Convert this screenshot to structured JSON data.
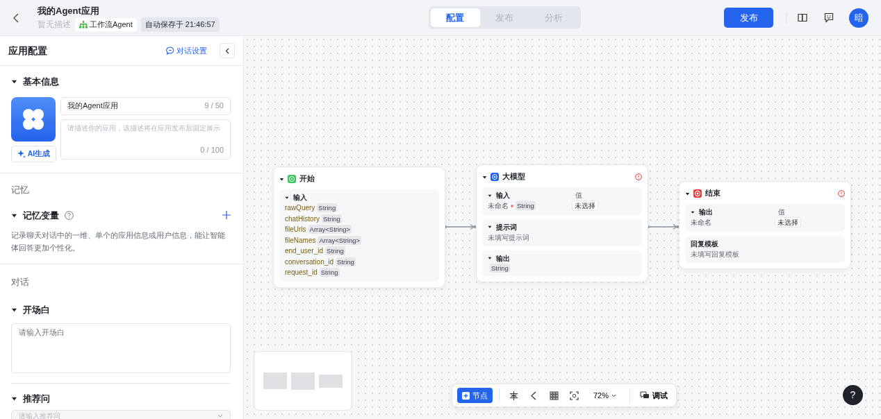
{
  "header": {
    "title": "我的Agent应用",
    "description": "暂无描述",
    "type_tag": "工作流Agent",
    "autosave": "自动保存于 21:46:57",
    "tabs": [
      {
        "label": "配置",
        "selected": true
      },
      {
        "label": "发布",
        "selected": false
      },
      {
        "label": "分析",
        "selected": false
      }
    ],
    "publish_button": "发布",
    "avatar": "暗"
  },
  "config_panel": {
    "title": "应用配置",
    "dialog_settings_link": "对话设置",
    "basic_info": {
      "heading": "基本信息",
      "expanded": true,
      "name_value": "我的Agent应用",
      "name_count": "9 / 50",
      "description_placeholder": "请描述你的应用，该描述将在应用发布后固定展示",
      "description_count": "0 / 100",
      "ai_button": "AI生成"
    },
    "memory": {
      "group_title": "记忆",
      "heading": "记忆变量",
      "expanded": true,
      "hint": "记录聊天对话中的一维、单个的应用信息或用户信息，能让智能体回答更加个性化。"
    },
    "dialog": {
      "group_title": "对话",
      "opening": {
        "heading": "开场白",
        "expanded": true,
        "placeholder": "请输入开场白"
      },
      "suggestions": {
        "heading": "推荐问",
        "expanded": true,
        "placeholder": "请输入推荐问"
      }
    }
  },
  "nodes": [
    {
      "kind": "start",
      "title": "开始",
      "color": "#3ec45e",
      "warning": false,
      "blocks": [
        {
          "heading": "输入",
          "collapsible": true,
          "rows": [
            {
              "name": "rawQuery",
              "type": "String"
            },
            {
              "name": "chatHistory",
              "type": "String"
            },
            {
              "name": "fileUrls",
              "type": "Array<String>"
            },
            {
              "name": "fileNames",
              "type": "Array<String>"
            },
            {
              "name": "end_user_id",
              "type": "String"
            },
            {
              "name": "conversation_id",
              "type": "String"
            },
            {
              "name": "request_id",
              "type": "String"
            }
          ]
        }
      ]
    },
    {
      "kind": "llm",
      "title": "大模型",
      "color": "#2463eb",
      "warning": true,
      "blocks": [
        {
          "heading": "输入",
          "collapsible": true,
          "value_heading": "值",
          "rows": [
            {
              "name": "未命名",
              "required": true,
              "type": "String",
              "value": "未选择"
            }
          ]
        },
        {
          "heading": "提示词",
          "collapsible": true,
          "note": "未填写提示词"
        },
        {
          "heading": "输出",
          "collapsible": true,
          "rows": [
            {
              "type": "String"
            }
          ]
        }
      ]
    },
    {
      "kind": "end",
      "title": "结束",
      "color": "#e9383b",
      "warning": true,
      "blocks": [
        {
          "heading": "输出",
          "collapsible": true,
          "value_heading": "值",
          "rows": [
            {
              "name": "未命名",
              "value": "未选择"
            }
          ]
        },
        {
          "heading": "回复模板",
          "collapsible": false,
          "note": "未填写回复模板"
        }
      ]
    }
  ],
  "toolbar": {
    "add_node_button": "节点",
    "zoom": "72%",
    "debug_button": "调试"
  },
  "help_button": "?"
}
